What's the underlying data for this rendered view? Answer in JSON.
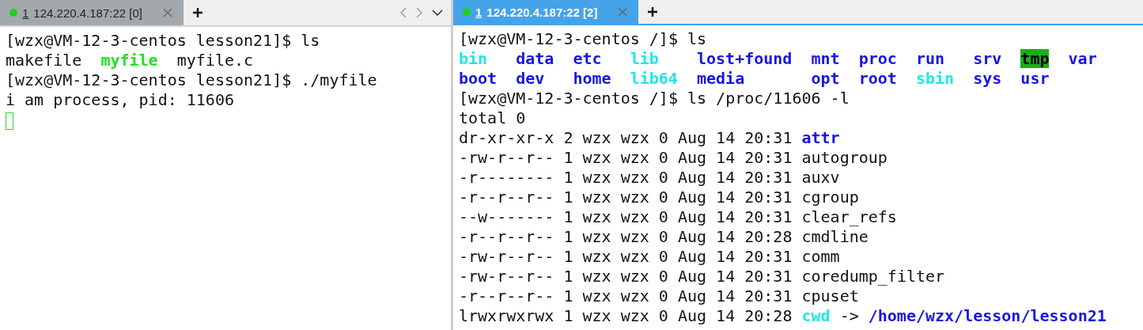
{
  "panes": [
    {
      "tabs": [
        {
          "number": "1",
          "label": "124.220.4.187:22 [0]",
          "selected": false,
          "connected": true
        }
      ],
      "nav_arrows": true,
      "lines": [
        {
          "kind": "prompt",
          "prompt": "[wzx@VM-12-3-centos lesson21]$",
          "command": "ls"
        },
        {
          "kind": "ls",
          "rows": [
            [
              {
                "name": "makefile",
                "kind": "file"
              },
              {
                "name": "myfile",
                "kind": "exec"
              },
              {
                "name": "myfile.c",
                "kind": "file"
              }
            ]
          ]
        },
        {
          "kind": "prompt",
          "prompt": "[wzx@VM-12-3-centos lesson21]$",
          "command": "./myfile"
        },
        {
          "kind": "output",
          "text": "i am process, pid: 11606"
        },
        {
          "kind": "cursor"
        }
      ]
    },
    {
      "tabs": [
        {
          "number": "1",
          "label": "124.220.4.187:22 [2]",
          "selected": true,
          "connected": true
        }
      ],
      "nav_arrows": false,
      "lines": [
        {
          "kind": "prompt",
          "prompt": "[wzx@VM-12-3-centos /]$",
          "command": "ls"
        },
        {
          "kind": "ls",
          "rows": [
            [
              {
                "name": "bin",
                "kind": "link"
              },
              {
                "name": "data",
                "kind": "dir"
              },
              {
                "name": "etc",
                "kind": "dir"
              },
              {
                "name": "lib",
                "kind": "link"
              },
              {
                "name": "lost+found",
                "kind": "dir"
              },
              {
                "name": "mnt",
                "kind": "dir"
              },
              {
                "name": "proc",
                "kind": "dir"
              },
              {
                "name": "run",
                "kind": "dir"
              },
              {
                "name": "srv",
                "kind": "dir"
              },
              {
                "name": "tmp",
                "kind": "sticky"
              },
              {
                "name": "var",
                "kind": "dir"
              }
            ],
            [
              {
                "name": "boot",
                "kind": "dir"
              },
              {
                "name": "dev",
                "kind": "dir"
              },
              {
                "name": "home",
                "kind": "dir"
              },
              {
                "name": "lib64",
                "kind": "link"
              },
              {
                "name": "media",
                "kind": "dir"
              },
              {
                "name": "opt",
                "kind": "dir"
              },
              {
                "name": "root",
                "kind": "dir"
              },
              {
                "name": "sbin",
                "kind": "link"
              },
              {
                "name": "sys",
                "kind": "dir"
              },
              {
                "name": "usr",
                "kind": "dir"
              }
            ]
          ]
        },
        {
          "kind": "prompt",
          "prompt": "[wzx@VM-12-3-centos /]$",
          "command": "ls /proc/11606 -l"
        },
        {
          "kind": "output",
          "text": "total 0"
        },
        {
          "kind": "entry",
          "info": "dr-xr-xr-x 2 wzx wzx 0 Aug 14 20:31",
          "file": {
            "name": "attr",
            "kind": "dir"
          }
        },
        {
          "kind": "entry",
          "info": "-rw-r--r-- 1 wzx wzx 0 Aug 14 20:31",
          "file": {
            "name": "autogroup",
            "kind": "file"
          }
        },
        {
          "kind": "entry",
          "info": "-r-------- 1 wzx wzx 0 Aug 14 20:31",
          "file": {
            "name": "auxv",
            "kind": "file"
          }
        },
        {
          "kind": "entry",
          "info": "-r--r--r-- 1 wzx wzx 0 Aug 14 20:31",
          "file": {
            "name": "cgroup",
            "kind": "file"
          }
        },
        {
          "kind": "entry",
          "info": "--w------- 1 wzx wzx 0 Aug 14 20:31",
          "file": {
            "name": "clear_refs",
            "kind": "file"
          }
        },
        {
          "kind": "entry",
          "info": "-r--r--r-- 1 wzx wzx 0 Aug 14 20:28",
          "file": {
            "name": "cmdline",
            "kind": "file"
          }
        },
        {
          "kind": "entry",
          "info": "-rw-r--r-- 1 wzx wzx 0 Aug 14 20:31",
          "file": {
            "name": "comm",
            "kind": "file"
          }
        },
        {
          "kind": "entry",
          "info": "-rw-r--r-- 1 wzx wzx 0 Aug 14 20:31",
          "file": {
            "name": "coredump_filter",
            "kind": "file"
          }
        },
        {
          "kind": "entry",
          "info": "-r--r--r-- 1 wzx wzx 0 Aug 14 20:31",
          "file": {
            "name": "cpuset",
            "kind": "file"
          }
        },
        {
          "kind": "entry",
          "info": "lrwxrwxrwx 1 wzx wzx 0 Aug 14 20:28",
          "file": {
            "name": "cwd",
            "kind": "link"
          },
          "arrow": "->",
          "target": {
            "name": "/home/wzx/lesson/lesson21",
            "kind": "dir"
          }
        }
      ]
    }
  ]
}
